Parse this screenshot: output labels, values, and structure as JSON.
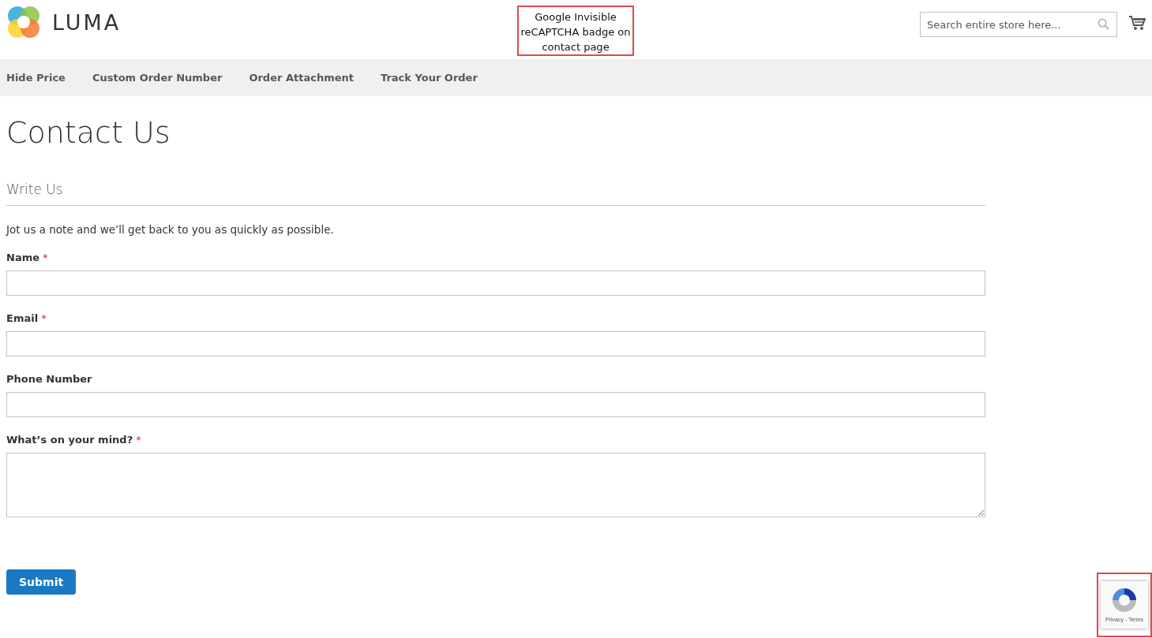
{
  "header": {
    "logo_text": "LUMA",
    "search": {
      "placeholder": "Search entire store here..."
    }
  },
  "annotation": {
    "text": "Google Invisible reCAPTCHA badge on contact page"
  },
  "nav": {
    "items": [
      {
        "label": "Hide Price"
      },
      {
        "label": "Custom Order Number"
      },
      {
        "label": "Order Attachment"
      },
      {
        "label": "Track Your Order"
      }
    ]
  },
  "page_title": "Contact Us",
  "form": {
    "legend": "Write Us",
    "intro": "Jot us a note and we’ll get back to you as quickly as possible.",
    "fields": [
      {
        "label": "Name",
        "kind": "input",
        "required_mark": "*"
      },
      {
        "label": "Email",
        "kind": "input",
        "required_mark": "*"
      },
      {
        "label": "Phone Number",
        "kind": "input"
      },
      {
        "label": "What’s on your mind?",
        "kind": "textarea",
        "required_mark": "*"
      }
    ],
    "submit": "Submit"
  },
  "recaptcha_badge": {
    "links": "Privacy - Terms",
    "highlighted": true
  }
}
